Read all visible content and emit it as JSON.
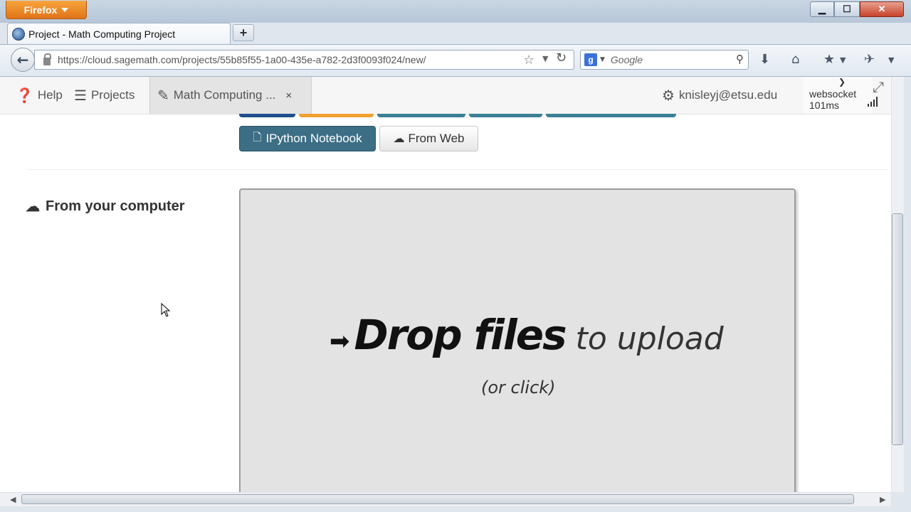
{
  "browser": {
    "menu_button": "Firefox",
    "window_buttons": {
      "minimize": "▁",
      "maximize": "☐",
      "close": "✕"
    },
    "tab": {
      "title": "Project - Math Computing Project"
    },
    "new_tab": "+",
    "url": "https://cloud.sagemath.com/projects/55b85f55-1a00-435e-a782-2d3f0093f024/new/",
    "search": {
      "placeholder": "Google",
      "engine_icon": "g"
    }
  },
  "app_nav": {
    "help": "Help",
    "projects": "Projects",
    "project_tab": "Math Computing ...",
    "project_tab_close": "×",
    "account": "knisleyj@etsu.edu",
    "websocket_label": "websocket",
    "websocket_latency": "101ms"
  },
  "create_buttons": {
    "ipython": "IPython Notebook",
    "from_web": "From Web",
    "cut_off_colors": [
      "#1f4f8e",
      "#f0a030",
      "#3c7f95",
      "#3c7f95",
      "#3c7f95"
    ]
  },
  "upload": {
    "heading": "From your computer",
    "drop_bold": "Drop files",
    "drop_light": "to upload",
    "drop_sub": "(or click)"
  }
}
